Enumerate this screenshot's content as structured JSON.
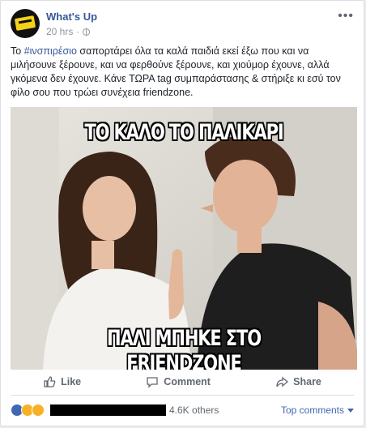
{
  "post": {
    "page_name": "What's Up",
    "time": "20 hrs",
    "separator": "·",
    "more_icon": "more-horizontal-icon",
    "text_pre": "Το ",
    "hashtag": "#ινσπιρέσιο",
    "text_post": " σαπορτάρει όλα τα καλά παιδιά εκεί έξω που και να μιλήσουνε ξέρουνε, και να φερθούνε ξέρουνε, και χιούμορ έχουνε, αλλά γκόμενα δεν έχουνε. Κάνε ΤΩΡΑ tag συμπαράστασης & στήριξε κι εσύ τον φίλο σου που τρώει συνέχεια friendzone."
  },
  "meme": {
    "top_caption": "ΤΟ ΚΑΛΟ ΤΟ ΠΑΛΙΚΑΡΙ",
    "bottom_caption": "ΠΑΛΙ ΜΠΗΚΕ ΣΤΟ FRIENDZONE"
  },
  "actions": {
    "like": "Like",
    "comment": "Comment",
    "share": "Share"
  },
  "reactions": {
    "others": "4.6K others",
    "top_comments": "Top comments"
  },
  "colors": {
    "link": "#365899",
    "accent": "#4267b2",
    "muted": "#90949c"
  }
}
